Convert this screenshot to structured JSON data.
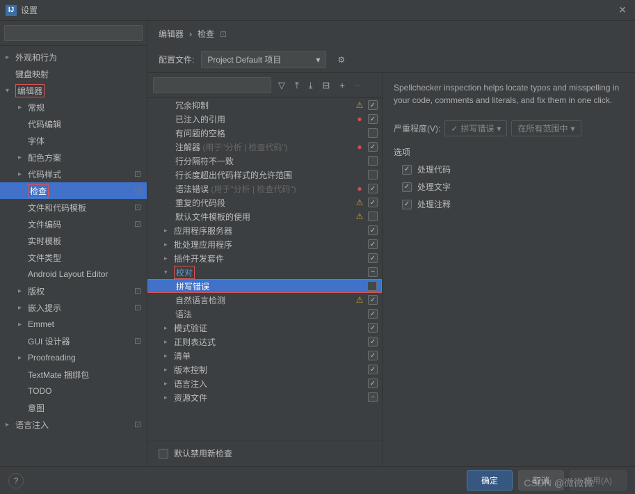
{
  "title": "设置",
  "breadcrumb": [
    "编辑器",
    "检查"
  ],
  "profile_label": "配置文件:",
  "profile_value": "Project Default 项目",
  "sidebar": [
    {
      "label": "外观和行为",
      "depth": 0,
      "chev": ">"
    },
    {
      "label": "键盘映射",
      "depth": 0,
      "chev": ""
    },
    {
      "label": "编辑器",
      "depth": 0,
      "chev": "v",
      "red": true
    },
    {
      "label": "常规",
      "depth": 1,
      "chev": ">"
    },
    {
      "label": "代码编辑",
      "depth": 1,
      "chev": ""
    },
    {
      "label": "字体",
      "depth": 1,
      "chev": ""
    },
    {
      "label": "配色方案",
      "depth": 1,
      "chev": ">"
    },
    {
      "label": "代码样式",
      "depth": 1,
      "chev": ">",
      "badge": "⊡"
    },
    {
      "label": "检查",
      "depth": 1,
      "chev": "",
      "selected": true,
      "red": true,
      "badge": "⊡"
    },
    {
      "label": "文件和代码模板",
      "depth": 1,
      "badge": "⊡"
    },
    {
      "label": "文件编码",
      "depth": 1,
      "badge": "⊡"
    },
    {
      "label": "实时模板",
      "depth": 1
    },
    {
      "label": "文件类型",
      "depth": 1
    },
    {
      "label": "Android Layout Editor",
      "depth": 1
    },
    {
      "label": "版权",
      "depth": 1,
      "chev": ">",
      "badge": "⊡"
    },
    {
      "label": "嵌入提示",
      "depth": 1,
      "chev": ">",
      "badge": "⊡"
    },
    {
      "label": "Emmet",
      "depth": 1,
      "chev": ">"
    },
    {
      "label": "GUI 设计器",
      "depth": 1,
      "badge": "⊡"
    },
    {
      "label": "Proofreading",
      "depth": 1,
      "chev": ">"
    },
    {
      "label": "TextMate 捆绑包",
      "depth": 1
    },
    {
      "label": "TODO",
      "depth": 1
    },
    {
      "label": "意图",
      "depth": 1
    },
    {
      "label": "语言注入",
      "depth": 0,
      "chev": ">",
      "badge": "⊡"
    }
  ],
  "inspections": [
    {
      "label": "冗余抑制",
      "depth": 2,
      "state": "warn",
      "cb": "checked"
    },
    {
      "label": "已注入的引用",
      "depth": 2,
      "state": "err",
      "cb": "checked"
    },
    {
      "label": "有问题的空格",
      "depth": 2,
      "cb": ""
    },
    {
      "label": "注解器",
      "hint": " (用于\"分析 | 检查代码\")",
      "depth": 2,
      "state": "err",
      "cb": "checked"
    },
    {
      "label": "行分隔符不一致",
      "depth": 2,
      "cb": ""
    },
    {
      "label": "行长度超出代码样式的允许范围",
      "depth": 2,
      "cb": ""
    },
    {
      "label": "语法错误",
      "hint": " (用于\"分析 | 检查代码\")",
      "depth": 2,
      "state": "err",
      "cb": "checked"
    },
    {
      "label": "重复的代码段",
      "depth": 2,
      "state": "warn",
      "cb": "checked"
    },
    {
      "label": "默认文件模板的使用",
      "depth": 2,
      "state": "warn",
      "cb": ""
    },
    {
      "label": "应用程序服务器",
      "depth": 1,
      "chev": ">",
      "cb": "checked"
    },
    {
      "label": "批处理应用程序",
      "depth": 1,
      "chev": ">",
      "cb": "checked"
    },
    {
      "label": "插件开发套件",
      "depth": 1,
      "chev": ">",
      "cb": "checked"
    },
    {
      "label": "校对",
      "depth": 1,
      "chev": "v",
      "cb": "minus",
      "red": true,
      "blue": true
    },
    {
      "label": "拼写错误",
      "depth": 2,
      "cb": "",
      "selected": true,
      "redrow": true
    },
    {
      "label": "自然语言检测",
      "depth": 2,
      "state": "warn",
      "cb": "checked"
    },
    {
      "label": "语法",
      "depth": 2,
      "cb": "checked"
    },
    {
      "label": "模式验证",
      "depth": 1,
      "chev": ">",
      "cb": "checked"
    },
    {
      "label": "正则表达式",
      "depth": 1,
      "chev": ">",
      "cb": "checked"
    },
    {
      "label": "清单",
      "depth": 1,
      "chev": ">",
      "cb": "checked"
    },
    {
      "label": "版本控制",
      "depth": 1,
      "chev": ">",
      "cb": "checked"
    },
    {
      "label": "语言注入",
      "depth": 1,
      "chev": ">",
      "cb": "checked"
    },
    {
      "label": "资源文件",
      "depth": 1,
      "chev": ">",
      "cb": "minus"
    }
  ],
  "default_disable": "默认禁用新检查",
  "description": "Spellchecker inspection helps locate typos and misspelling in your code, comments and literals, and fix them in one click.",
  "severity_label": "严重程度(V):",
  "severity_pill": "拼写错误",
  "scope_pill": "在所有范围中",
  "options_title": "选项",
  "options": [
    {
      "label": "处理代码",
      "checked": true
    },
    {
      "label": "处理文字",
      "checked": true
    },
    {
      "label": "处理注释",
      "checked": true
    }
  ],
  "buttons": {
    "ok": "确定",
    "cancel": "取消",
    "apply": "应用(A)"
  },
  "watermark": "CSDN @微微微"
}
